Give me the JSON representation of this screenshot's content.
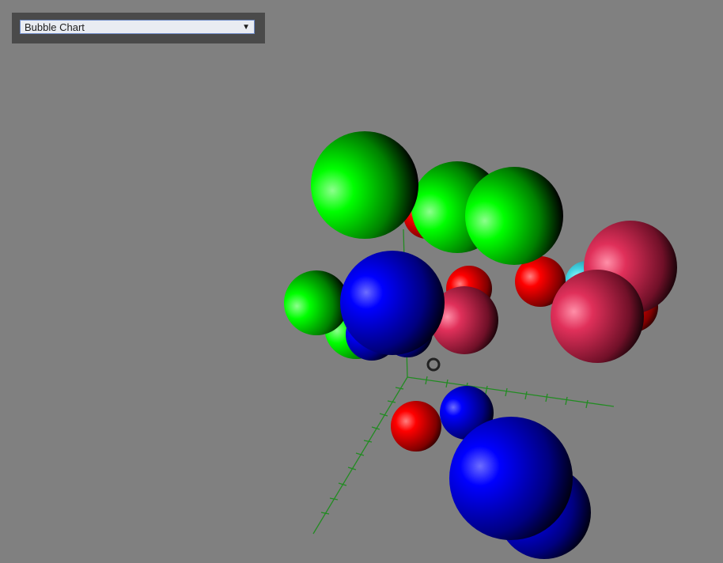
{
  "chart_selector": {
    "selected": "Bubble Chart",
    "arrow": "▼"
  },
  "scene": {
    "type": "3d-bubble-chart",
    "axis_color": "#228b22",
    "cursor_ring": "rotation-center-marker",
    "bubble_colors": {
      "green": "#00ff00",
      "blue": "#0000ff",
      "red": "#ff0000",
      "pink": "#e0305a",
      "cyan": "#40d0e0"
    }
  }
}
